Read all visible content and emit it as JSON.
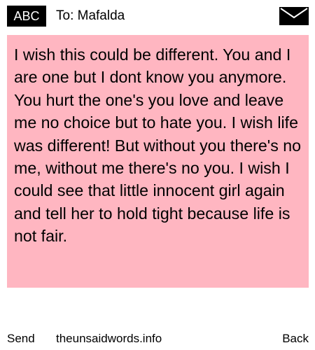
{
  "header": {
    "badge_label": "ABC",
    "to_label": "To: Mafalda",
    "envelope_icon": "envelope-icon"
  },
  "message": {
    "text": "I wish this could be different. You and I are one but I dont know you anymore. You hurt the one's you love and leave me no choice but to hate you. I wish life was different! But without you there's no me, without me there's no you. I wish I could see that little innocent girl again and tell her to hold tight because life is not fair.",
    "background_color": "#ffb6c1"
  },
  "footer": {
    "send_label": "Send",
    "site_label": "theunsaidwords.info",
    "back_label": "Back"
  }
}
